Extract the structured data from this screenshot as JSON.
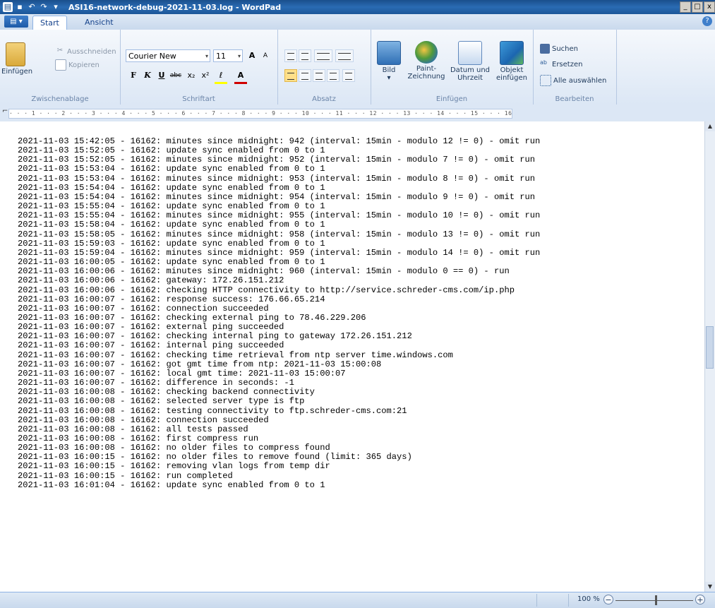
{
  "window": {
    "title": "ASI16-network-debug-2021-11-03.log - WordPad",
    "controls": [
      "_",
      "□",
      "x"
    ]
  },
  "tabs": {
    "menu_label": "▤ ▾",
    "items": [
      "Start",
      "Ansicht"
    ]
  },
  "ribbon": {
    "clipboard": {
      "paste_label": "Einfügen",
      "cut_label": "Ausschneiden",
      "copy_label": "Kopieren",
      "group_label": "Zwischenablage"
    },
    "font": {
      "family": "Courier New",
      "size": "11",
      "grow": "A",
      "shrink": "A",
      "bold": "F",
      "italic": "K",
      "underline": "U",
      "strike": "abc",
      "subscript": "x₂",
      "superscript": "x²",
      "highlight": "ℓ",
      "color": "A",
      "group_label": "Schriftart"
    },
    "paragraph": {
      "group_label": "Absatz"
    },
    "insert": {
      "picture_label": "Bild",
      "paint_label_1": "Paint-",
      "paint_label_2": "Zeichnung",
      "datetime_label_1": "Datum und",
      "datetime_label_2": "Uhrzeit",
      "object_label_1": "Objekt",
      "object_label_2": "einfügen",
      "group_label": "Einfügen"
    },
    "edit": {
      "find_label": "Suchen",
      "replace_label": "Ersetzen",
      "select_all_label": "Alle auswählen",
      "group_label": "Bearbeiten"
    }
  },
  "ruler": {
    "text": "· · · 1 · · · 2 · · · 3 · · · 4 · · · 5 · · · 6 · · · 7 · · · 8 · · · 9 · · · 10 · · · 11 · · · 12 · · · 13 · · · 14 · · · 15 · · · 16 · · · 17 · · · 18 ·"
  },
  "document": {
    "text": "2021-11-03 15:42:05 - 16162: minutes since midnight: 942 (interval: 15min - modulo 12 != 0) - omit run\n2021-11-03 15:52:05 - 16162: update sync enabled from 0 to 1\n2021-11-03 15:52:05 - 16162: minutes since midnight: 952 (interval: 15min - modulo 7 != 0) - omit run\n2021-11-03 15:53:04 - 16162: update sync enabled from 0 to 1\n2021-11-03 15:53:04 - 16162: minutes since midnight: 953 (interval: 15min - modulo 8 != 0) - omit run\n2021-11-03 15:54:04 - 16162: update sync enabled from 0 to 1\n2021-11-03 15:54:04 - 16162: minutes since midnight: 954 (interval: 15min - modulo 9 != 0) - omit run\n2021-11-03 15:55:04 - 16162: update sync enabled from 0 to 1\n2021-11-03 15:55:04 - 16162: minutes since midnight: 955 (interval: 15min - modulo 10 != 0) - omit run\n2021-11-03 15:58:04 - 16162: update sync enabled from 0 to 1\n2021-11-03 15:58:05 - 16162: minutes since midnight: 958 (interval: 15min - modulo 13 != 0) - omit run\n2021-11-03 15:59:03 - 16162: update sync enabled from 0 to 1\n2021-11-03 15:59:04 - 16162: minutes since midnight: 959 (interval: 15min - modulo 14 != 0) - omit run\n2021-11-03 16:00:05 - 16162: update sync enabled from 0 to 1\n2021-11-03 16:00:06 - 16162: minutes since midnight: 960 (interval: 15min - modulo 0 == 0) - run\n2021-11-03 16:00:06 - 16162: gateway: 172.26.151.212\n2021-11-03 16:00:06 - 16162: checking HTTP connectivity to http://service.schreder-cms.com/ip.php\n2021-11-03 16:00:07 - 16162: response success: 176.66.65.214\n2021-11-03 16:00:07 - 16162: connection succeeded\n2021-11-03 16:00:07 - 16162: checking external ping to 78.46.229.206\n2021-11-03 16:00:07 - 16162: external ping succeeded\n2021-11-03 16:00:07 - 16162: checking internal ping to gateway 172.26.151.212\n2021-11-03 16:00:07 - 16162: internal ping succeeded\n2021-11-03 16:00:07 - 16162: checking time retrieval from ntp server time.windows.com\n2021-11-03 16:00:07 - 16162: got gmt time from ntp: 2021-11-03 15:00:08\n2021-11-03 16:00:07 - 16162: local gmt time: 2021-11-03 15:00:07\n2021-11-03 16:00:07 - 16162: difference in seconds: -1\n2021-11-03 16:00:08 - 16162: checking backend connectivity\n2021-11-03 16:00:08 - 16162: selected server type is ftp\n2021-11-03 16:00:08 - 16162: testing connectivity to ftp.schreder-cms.com:21\n2021-11-03 16:00:08 - 16162: connection succeeded\n2021-11-03 16:00:08 - 16162: all tests passed\n2021-11-03 16:00:08 - 16162: first compress run\n2021-11-03 16:00:08 - 16162: no older files to compress found\n2021-11-03 16:00:15 - 16162: no older files to remove found (limit: 365 days)\n2021-11-03 16:00:15 - 16162: removing vlan logs from temp dir\n2021-11-03 16:00:15 - 16162: run completed\n2021-11-03 16:01:04 - 16162: update sync enabled from 0 to 1"
  },
  "status": {
    "zoom_label": "100 %",
    "zoom_out": "−",
    "zoom_in": "+",
    "zoom_percent": 100
  },
  "icons": {
    "paste": "clipboard-icon",
    "picture": "picture-icon",
    "paint": "paint-icon",
    "datetime": "calendar-icon",
    "object": "object-icon",
    "find": "binoculars-icon"
  }
}
